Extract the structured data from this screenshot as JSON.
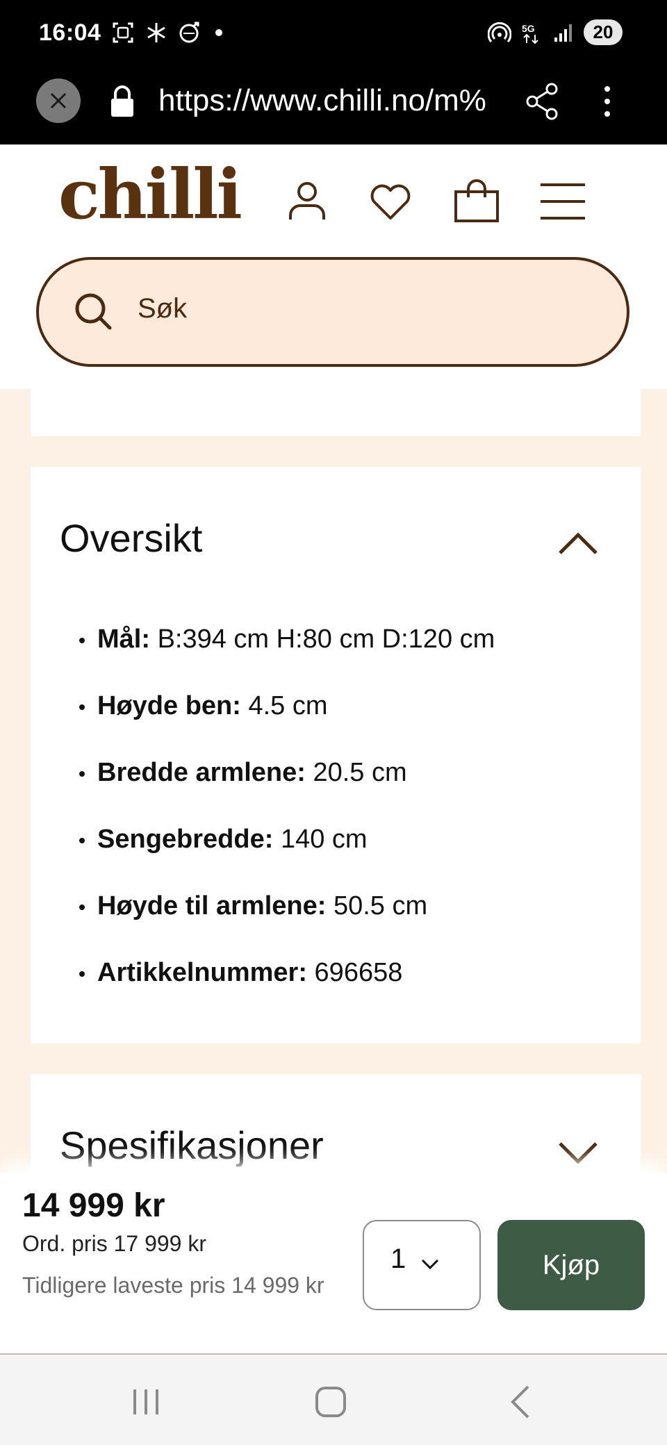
{
  "status_bar": {
    "time": "16:04",
    "battery": "20",
    "left_icons": [
      "screenshot-icon",
      "snowflake-icon",
      "volvo-icon",
      "dot-icon"
    ],
    "right_icons": [
      "hotspot-icon",
      "5g-icon",
      "signal-icon"
    ]
  },
  "browser": {
    "url": "https://www.chilli.no/m%",
    "icons": [
      "close-icon",
      "lock-icon",
      "share-icon",
      "more-icon"
    ]
  },
  "header": {
    "logo": "chilli",
    "icons": [
      "user-icon",
      "heart-icon",
      "bag-icon",
      "menu-icon"
    ],
    "search_placeholder": "Søk"
  },
  "overview": {
    "title": "Oversikt",
    "items": [
      {
        "key": "Mål:",
        "value": "B:394 cm H:80 cm D:120 cm"
      },
      {
        "key": "Høyde ben:",
        "value": "4.5 cm"
      },
      {
        "key": "Bredde armlene:",
        "value": "20.5 cm"
      },
      {
        "key": "Sengebredde:",
        "value": "140 cm"
      },
      {
        "key": "Høyde til armlene:",
        "value": "50.5 cm"
      },
      {
        "key": "Artikkelnummer:",
        "value": "696658"
      }
    ]
  },
  "specifications": {
    "title": "Spesifikasjoner"
  },
  "buy_bar": {
    "price": "14 999 kr",
    "ord_price": "Ord. pris 17 999 kr",
    "previous_lowest": "Tidligere laveste pris 14 999 kr",
    "quantity": "1",
    "buy_label": "Kjøp"
  },
  "colors": {
    "brand_brown": "#5a3210",
    "buy_green": "#3e5c45",
    "search_bg": "#fdeadb",
    "page_bg": "#fdf0e4"
  },
  "nav_bar": {
    "icons": [
      "recent-apps-icon",
      "home-icon",
      "back-icon"
    ]
  }
}
